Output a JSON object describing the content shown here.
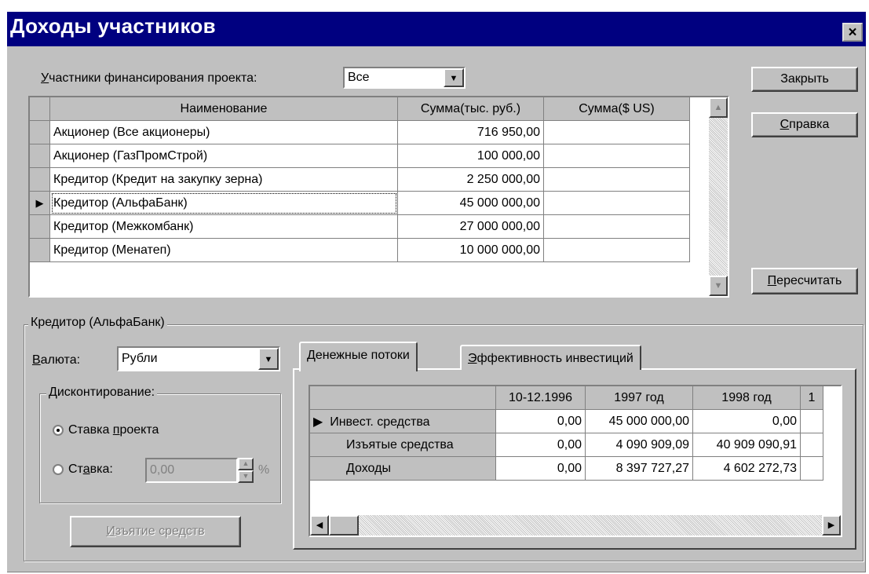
{
  "window": {
    "title": "Доходы участников",
    "close_glyph": "×"
  },
  "participants": {
    "label_prefix": "",
    "label_underlined": "У",
    "label_rest": "частники финансирования проекта:",
    "selected": "Все"
  },
  "buttons": {
    "close": "Закрыть",
    "help_u": "С",
    "help_rest": "правка",
    "recalc_u": "П",
    "recalc_rest": "ересчитать",
    "withdraw_u": "И",
    "withdraw_rest": "зъятие средств"
  },
  "main_table": {
    "headers": [
      "Наименование",
      "Сумма(тыс. руб.)",
      "Сумма($ US)"
    ],
    "rows": [
      {
        "name": "Акционер (Все акционеры)",
        "rub": "716 950,00",
        "usd": ""
      },
      {
        "name": "Акционер (ГазПромСтрой)",
        "rub": "100 000,00",
        "usd": ""
      },
      {
        "name": "Кредитор (Кредит на закупку зерна)",
        "rub": "2 250 000,00",
        "usd": ""
      },
      {
        "name": "Кредитор (АльфаБанк)",
        "rub": "45 000 000,00",
        "usd": ""
      },
      {
        "name": "Кредитор (Межкомбанк)",
        "rub": "27 000 000,00",
        "usd": ""
      },
      {
        "name": "Кредитор (Менатеп)",
        "rub": "10 000 000,00",
        "usd": ""
      }
    ],
    "current_row_marker": "▶"
  },
  "details": {
    "group_title": "Кредитор (АльфаБанк)",
    "currency_u": "В",
    "currency_rest": "алюта:",
    "currency_value": "Рубли",
    "discount_title": "Дисконтирование:",
    "radio_project_pre": "Ставка ",
    "radio_project_u": "п",
    "radio_project_rest": "роекта",
    "radio_rate_pre": "Ст",
    "radio_rate_u": "а",
    "radio_rate_rest": "вка:",
    "rate_value": "0,00",
    "percent": "%"
  },
  "tabs": {
    "cash_flows": "Денежные потоки",
    "efficiency_u": "Э",
    "efficiency_rest": "ффективность инвестиций"
  },
  "flows_table": {
    "headers": [
      "",
      "10-12.1996",
      "1997 год",
      "1998 год",
      "1"
    ],
    "rows": [
      {
        "name": "Инвест. средства",
        "v1": "0,00",
        "v2": "45 000 000,00",
        "v3": "0,00"
      },
      {
        "name": "Изъятые средства",
        "v1": "0,00",
        "v2": "4 090 909,09",
        "v3": "40 909 090,91"
      },
      {
        "name": "Доходы",
        "v1": "0,00",
        "v2": "8 397 727,27",
        "v3": "4 602 272,73"
      }
    ]
  }
}
